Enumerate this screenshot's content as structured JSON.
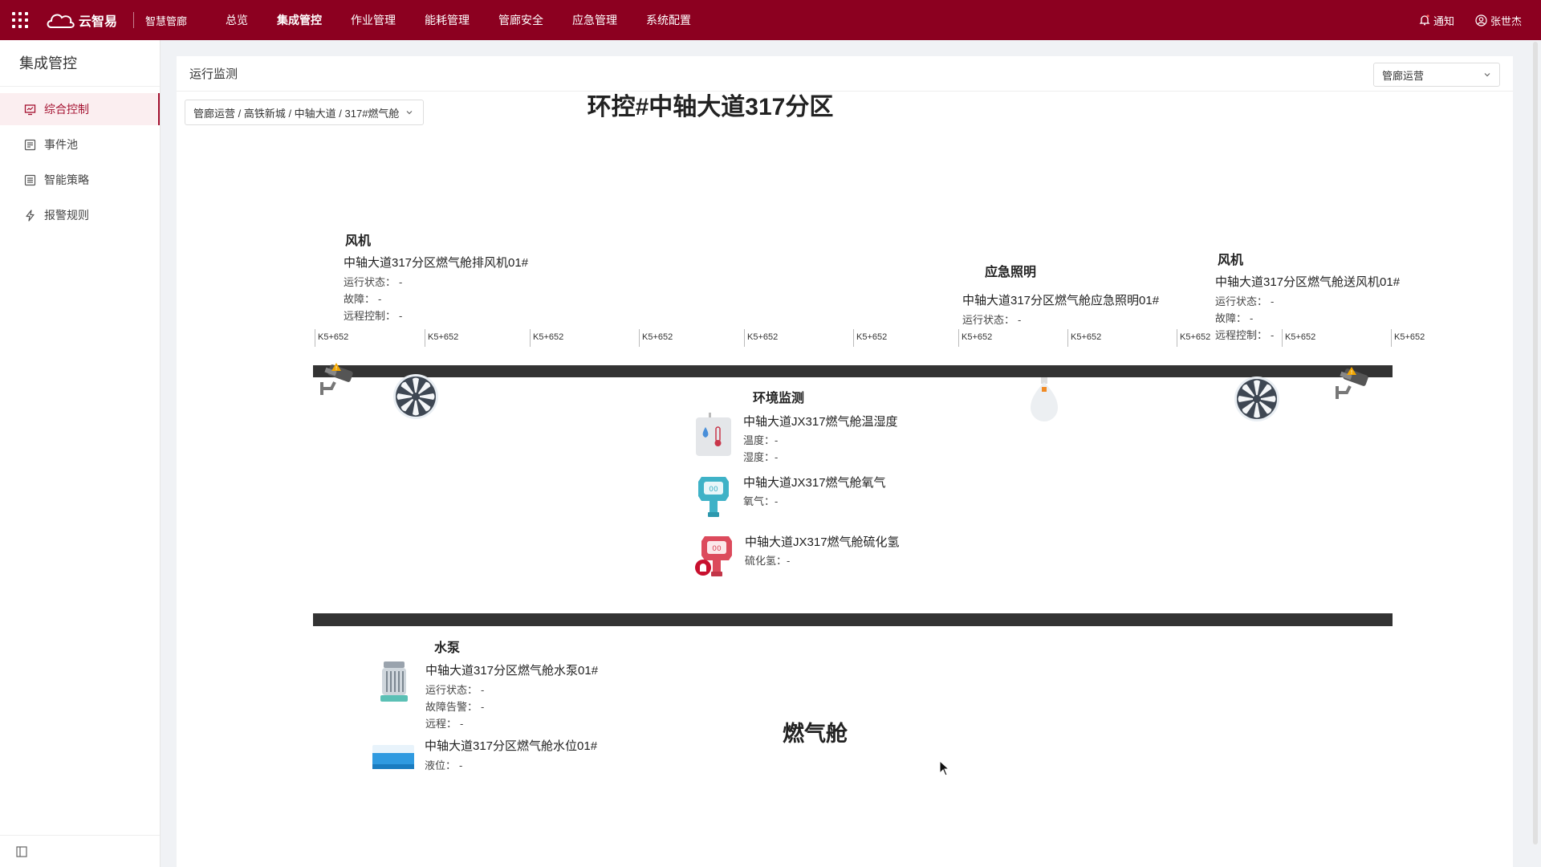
{
  "topbar": {
    "brand": "云智易",
    "product": "智慧管廊",
    "nav": [
      "总览",
      "集成管控",
      "作业管理",
      "能耗管理",
      "管廊安全",
      "应急管理",
      "系统配置"
    ],
    "active_nav": "集成管控",
    "notify": "通知",
    "user": "张世杰",
    "accent": "#8c0020"
  },
  "sidebar": {
    "title": "集成管控",
    "items": [
      {
        "label": "综合控制",
        "icon": "monitor-icon",
        "active": true
      },
      {
        "label": "事件池",
        "icon": "list-icon",
        "active": false
      },
      {
        "label": "智能策略",
        "icon": "strategy-icon",
        "active": false
      },
      {
        "label": "报警规则",
        "icon": "lightning-icon",
        "active": false
      }
    ]
  },
  "main": {
    "header": "运行监测",
    "top_select": "管廊运营",
    "crumb_select": "管廊运营 / 高铁新城 / 中轴大道 / 317#燃气舱",
    "title": "环控#中轴大道317分区",
    "mileage_label": "K5+652",
    "cabin_label": "燃气舱"
  },
  "devices": {
    "fan_left": {
      "category": "风机",
      "name": "中轴大道317分区燃气舱排风机01#",
      "rows": [
        [
          "运行状态：",
          "-"
        ],
        [
          "故障：",
          "-"
        ],
        [
          "远程控制：",
          "-"
        ]
      ]
    },
    "light": {
      "category": "应急照明",
      "name": "中轴大道317分区燃气舱应急照明01#",
      "rows": [
        [
          "运行状态：",
          "-"
        ]
      ]
    },
    "fan_right": {
      "category": "风机",
      "name": "中轴大道317分区燃气舱送风机01#",
      "rows": [
        [
          "运行状态：",
          "-"
        ],
        [
          "故障：",
          "-"
        ],
        [
          "远程控制：",
          "-"
        ]
      ]
    },
    "env": {
      "category": "环境监测",
      "items": [
        {
          "name": "中轴大道JX317燃气舱温湿度",
          "rows": [
            [
              "温度：",
              "-"
            ],
            [
              "湿度：",
              "-"
            ]
          ]
        },
        {
          "name": "中轴大道JX317燃气舱氧气",
          "rows": [
            [
              "氧气：",
              "-"
            ]
          ]
        },
        {
          "name": "中轴大道JX317燃气舱硫化氢",
          "rows": [
            [
              "硫化氢：",
              "-"
            ]
          ]
        }
      ]
    },
    "pump": {
      "category": "水泵",
      "name": "中轴大道317分区燃气舱水泵01#",
      "rows": [
        [
          "运行状态：",
          "-"
        ],
        [
          "故障告警：",
          "-"
        ],
        [
          "远程：",
          "-"
        ]
      ]
    },
    "water_level": {
      "name": "中轴大道317分区燃气舱水位01#",
      "rows": [
        [
          "液位：",
          "-"
        ]
      ]
    }
  }
}
